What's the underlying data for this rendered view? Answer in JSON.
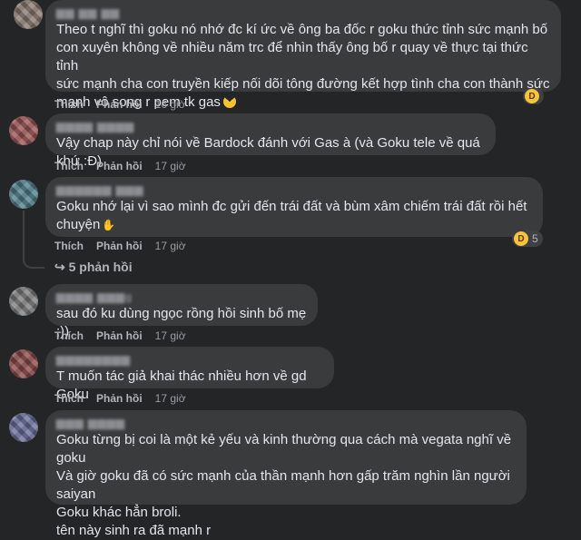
{
  "labels": {
    "like": "Thích",
    "reply": "Phản hồi"
  },
  "comments": [
    {
      "name": "▆▆ ▆▆ ▆▆",
      "text": "Theo t nghĩ thì goku nó nhớ đc kí ức về ông ba đốc r goku thức tỉnh sức mạnh bố\ncon xuyên không về nhiều năm trc để nhìn thấy ông bố r quay về thực tại thức tỉnh\nsức mạnh cha con truyền kiếp nối dõi tông đường kết hợp tình cha con thành sức\nmạnh vô song r pem tk gas",
      "time": "16 giờ",
      "avatar_color": "#8a7a72"
    },
    {
      "name": "▆▆▆▆ ▆▆▆▆",
      "text": "Vậy chap này chỉ nói về Bardock đánh với Gas à (và Goku tele về quá khứ :Đ)",
      "time": "17 giờ",
      "avatar_color": "#9b5555"
    },
    {
      "name": "▆▆▆▆▆▆ ▆▆▆",
      "text": "Goku nhớ lại vì sao mình đc gửi đến trái đất và bùm xâm chiếm trái đất rồi hết\nchuyện",
      "time": "17 giờ",
      "avatar_color": "#4f7e8a",
      "reaction_count": "5",
      "replies": "5 phản hồi"
    },
    {
      "name": "▆▆▆▆ ▆▆▆g",
      "text": "sau đó ku dùng ngọc rồng hồi sinh bố mẹ ;))",
      "time": "17 giờ",
      "avatar_color": "#7d7d7d"
    },
    {
      "name": "▆▆▆▆▆▆▆▆",
      "text": "T muốn tác giả khai thác nhiều hơn về gd Goku",
      "time": "17 giờ",
      "avatar_color": "#8a4a4a"
    },
    {
      "name": "▆▆▆ ▆▆▆▆",
      "text": "Goku từng bị coi là một kẻ yếu và kinh thường qua cách mà vegata nghĩ về goku\nVà giờ goku đã có sức mạnh của thần mạnh hơn gấp trăm nghìn lần người saiyan\nGoku khác hẳn broli.\ntên này sinh ra đã mạnh r",
      "time": "",
      "avatar_color": "#6b6d9a"
    }
  ]
}
